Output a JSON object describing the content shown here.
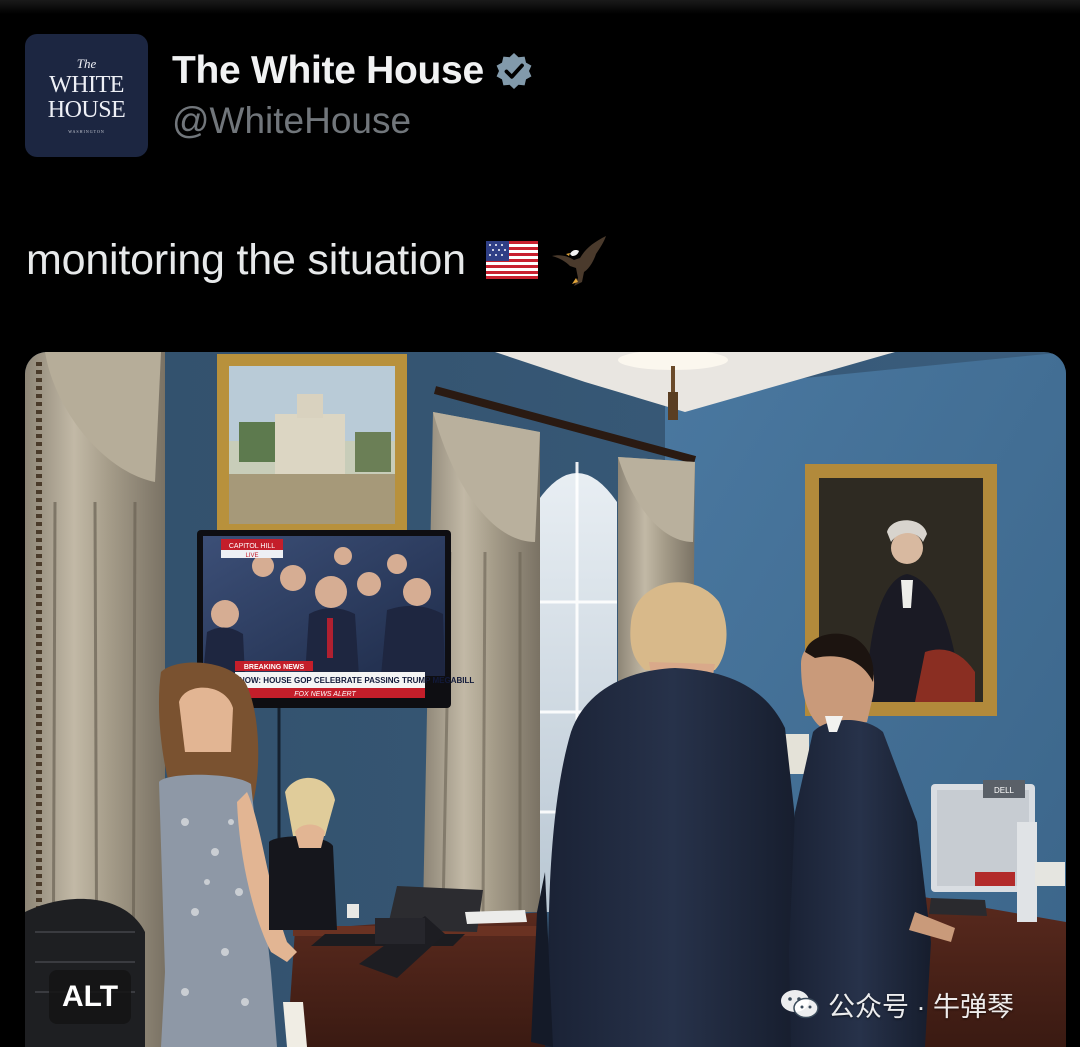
{
  "account": {
    "display_name": "The White House",
    "handle": "@WhiteHouse",
    "verified": true,
    "avatar_logo": {
      "line1": "The",
      "line2": "WHITE",
      "line3": "HOUSE",
      "sub": "WASHINGTON"
    }
  },
  "tweet": {
    "text": "monitoring the situation",
    "emojis": [
      "us-flag-emoji",
      "eagle-emoji"
    ]
  },
  "media": {
    "alt_badge": "ALT",
    "tv": {
      "location_tag": "CAPITOL HILL",
      "live_tag": "LIVE",
      "breaking": "BREAKING NEWS",
      "headline": "NOW: HOUSE GOP CELEBRATE PASSING TRUMP MEGABILL",
      "ticker": "FOX NEWS ALERT"
    },
    "monitor_label": "DELL"
  },
  "watermark": {
    "text": "公众号 · 牛弹琴"
  },
  "colors": {
    "background": "#000000",
    "handle": "#71767b",
    "verified_badge": "#829aab",
    "wall_blue": "#3d6688"
  }
}
